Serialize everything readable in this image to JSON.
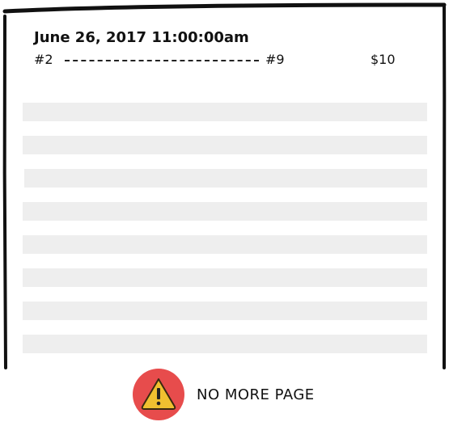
{
  "ticket": {
    "datetime": "June 26, 2017 11:00:00am",
    "from_stop": "#2",
    "to_stop": "#9",
    "price": "$10"
  },
  "placeholder_rows": 8,
  "footer": {
    "icon": "warning-icon",
    "message": "NO MORE PAGE"
  },
  "colors": {
    "badge": "#e74c4c",
    "triangle": "#f0c030",
    "placeholder": "#eeeeee",
    "border": "#111111"
  }
}
